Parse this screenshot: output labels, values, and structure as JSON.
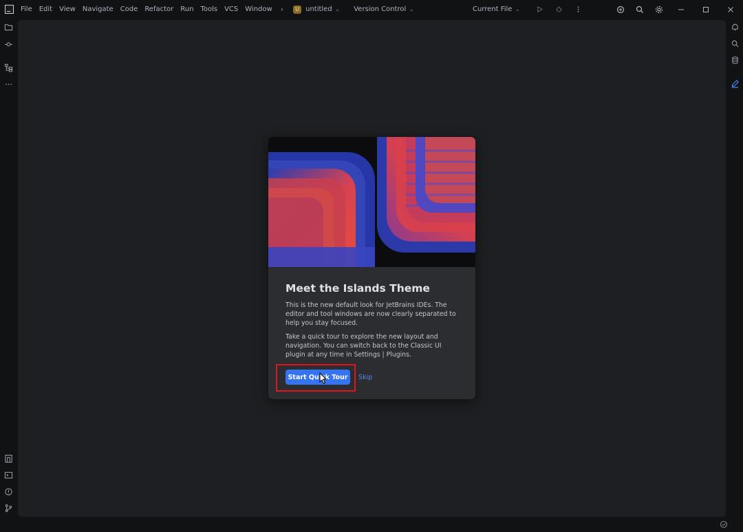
{
  "menu": [
    "File",
    "Edit",
    "View",
    "Navigate",
    "Code",
    "Refactor",
    "Run",
    "Tools",
    "VCS",
    "Window"
  ],
  "menu_more": "›",
  "project": {
    "badge": "U",
    "name": "untitled",
    "caret": "⌄"
  },
  "vcs": {
    "label": "Version Control",
    "caret": "⌄"
  },
  "run_config": {
    "label": "Current File",
    "caret": "⌄"
  },
  "dialog": {
    "title": "Meet the Islands Theme",
    "paragraph1": "This is the new default look for JetBrains IDEs. The editor and tool windows are now clearly separated to help you stay focused.",
    "paragraph2": "Take a quick tour to explore the new layout and navigation. You can switch back to the Classic UI plugin at any time in Settings | Plugins.",
    "primary_button": "Start Quick Tour",
    "secondary_link": "Skip"
  },
  "colors": {
    "accent": "#3574f0",
    "link": "#548af7",
    "highlight": "#e3141b",
    "editor_bg": "#1e1f22",
    "frame_bg": "#111214"
  },
  "icons": {
    "left": [
      "folder-icon",
      "commit-icon",
      "structure-icon",
      "more-icon"
    ],
    "left_bottom": [
      "services-icon",
      "terminal-icon",
      "problems-icon",
      "git-icon"
    ],
    "right": [
      "notifications-icon",
      "ai-assistant-icon",
      "database-icon",
      "edit-icon"
    ]
  }
}
